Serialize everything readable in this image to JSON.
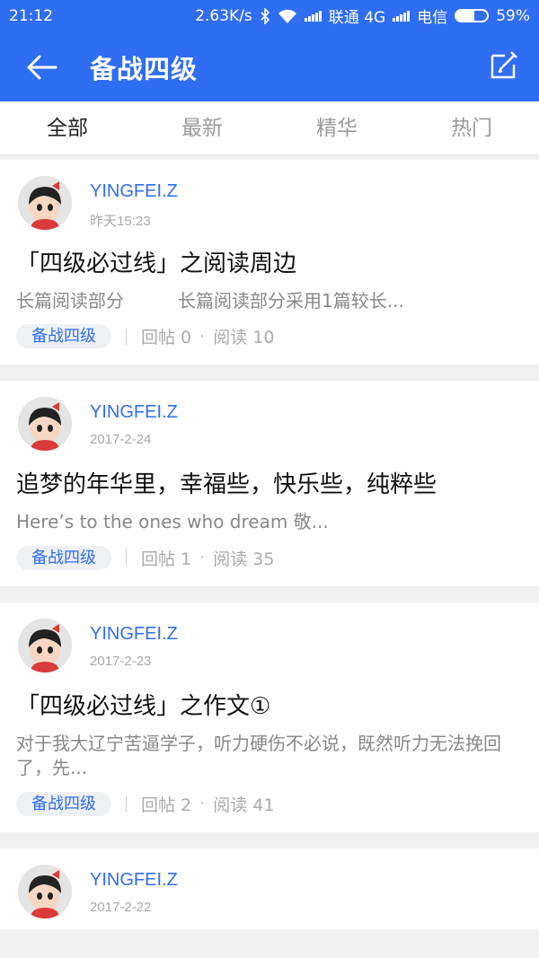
{
  "status_bar": {
    "time": "21:12",
    "speed": "2.63K/s",
    "carrier1": "联通 4G",
    "carrier2": "电信",
    "battery": "59%",
    "battery_level": 0.59,
    "icons": [
      "bluetooth-icon",
      "wifi-icon",
      "signal-icon",
      "battery-icon"
    ]
  },
  "header": {
    "title": "备战四级",
    "back_icon": "arrow-left-icon",
    "edit_icon": "edit-icon"
  },
  "tabs": [
    {
      "label": "全部",
      "active": true
    },
    {
      "label": "最新",
      "active": false
    },
    {
      "label": "精华",
      "active": false
    },
    {
      "label": "热门",
      "active": false
    }
  ],
  "posts": [
    {
      "author": "YINGFEI.Z",
      "time": "昨天15:23",
      "title": "「四级必过线」之阅读周边",
      "excerpt": "长篇阅读部分　　　长篇阅读部分采用1篇较长...",
      "tag": "备战四级",
      "replies": "回帖 0",
      "reads": "阅读 10"
    },
    {
      "author": "YINGFEI.Z",
      "time": "2017-2-24",
      "title": "追梦的年华里，幸福些，快乐些，纯粹些",
      "excerpt": "Here’s to the ones who dream 敬...",
      "tag": "备战四级",
      "replies": "回帖 1",
      "reads": "阅读 35"
    },
    {
      "author": "YINGFEI.Z",
      "time": "2017-2-23",
      "title": "「四级必过线」之作文①",
      "excerpt": "对于我大辽宁苦逼学子，听力硬伤不必说，既然听力无法挽回了，先...",
      "tag": "备战四级",
      "replies": "回帖 2",
      "reads": "阅读 41"
    },
    {
      "author": "YINGFEI.Z",
      "time": "2017-2-22"
    }
  ],
  "colors": {
    "brand": "#2f6df2",
    "background": "#f0f0f0",
    "tag_bg": "#eef0f4"
  }
}
